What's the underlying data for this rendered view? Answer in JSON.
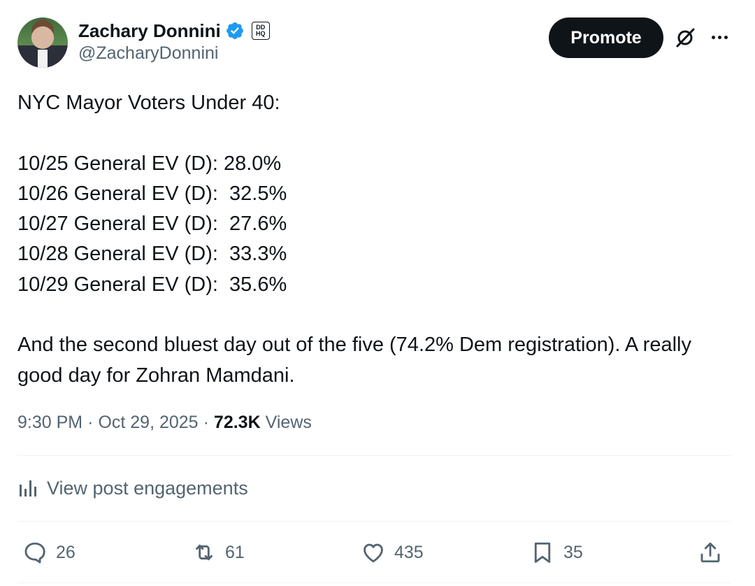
{
  "author": {
    "display_name": "Zachary Donnini",
    "handle": "@ZacharyDonnini",
    "affiliate_badge_top": "DD",
    "affiliate_badge_bottom": "HQ",
    "verified_color": "#1d9bf0"
  },
  "header": {
    "promote_label": "Promote",
    "grok_icon": "grok-icon",
    "more_icon": "more-icon"
  },
  "post": {
    "lines": [
      "NYC Mayor Voters Under 40:",
      "",
      "10/25 General EV (D): 28.0%",
      "10/26 General EV (D):  32.5%",
      "10/27 General EV (D):  27.6%",
      "10/28 General EV (D):  33.3%",
      "10/29 General EV (D):  35.6%",
      ""
    ],
    "closing": "And the second bluest day out of the five (74.2% Dem registration). A really good day for Zohran Mamdani."
  },
  "meta": {
    "time": "9:30 PM",
    "dot1": "·",
    "date": "Oct 29, 2025",
    "dot2": "·",
    "views_count": "72.3K",
    "views_label": "Views"
  },
  "engagements": {
    "label": "View post engagements",
    "icon": "analytics-icon"
  },
  "actions": {
    "reply_count": "26",
    "repost_count": "61",
    "like_count": "435",
    "bookmark_count": "35"
  },
  "colors": {
    "text": "#0f1419",
    "secondary": "#536471",
    "button_bg": "#0f1419",
    "divider": "#eff3f4"
  }
}
